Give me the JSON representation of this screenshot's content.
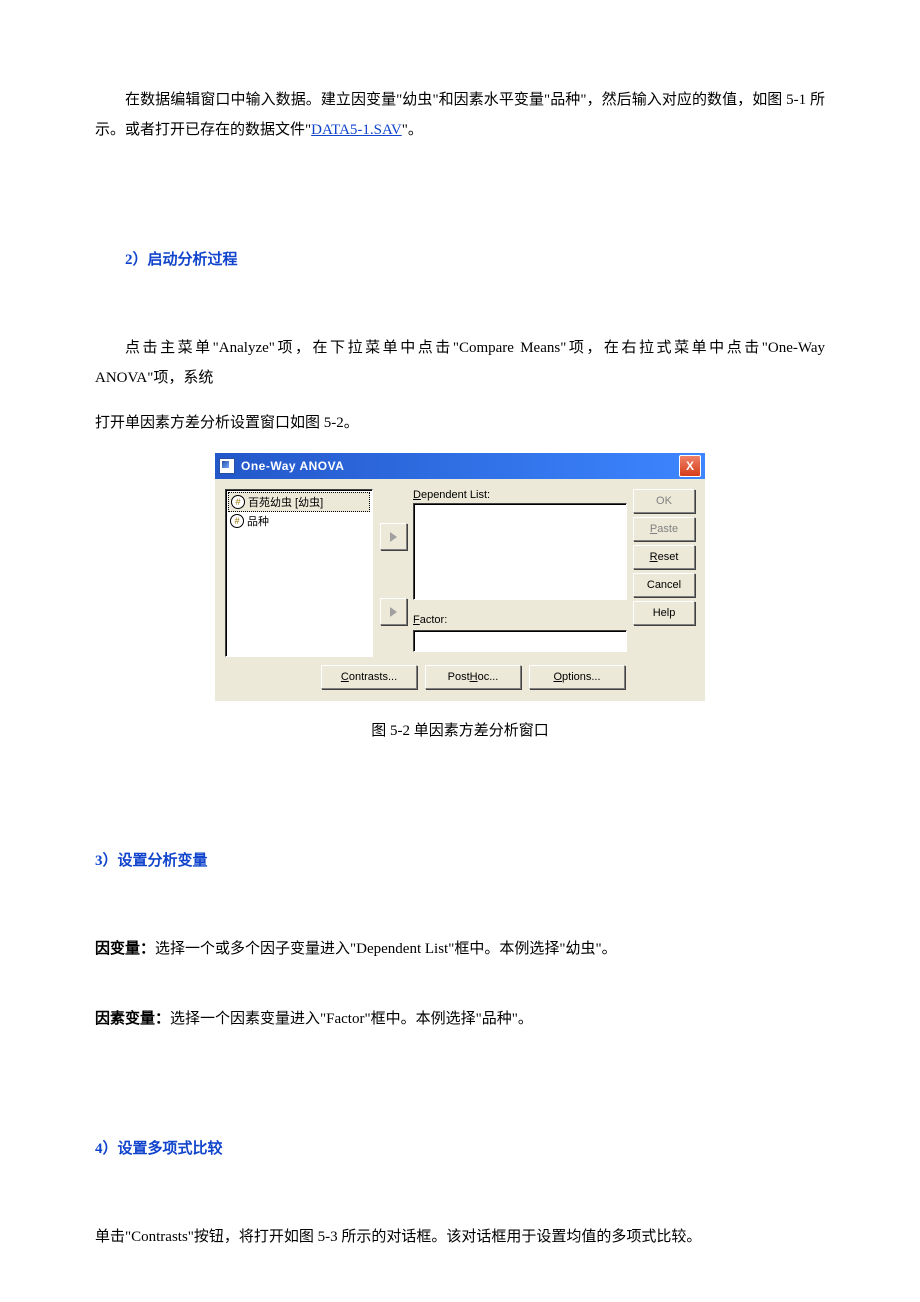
{
  "p1_a": "在数据编辑窗口中输入数据。建立因变量\"幼虫\"和因素水平变量\"品种\"，然后输入对应的数值，如图 5-1 所示。或者打开已存在的数据文件\"",
  "p1_link": "DATA5-1.SAV",
  "p1_b": "\"。",
  "sec2": "2）启动分析过程",
  "p2_a": "点击主菜单\"Analyze\"项，在下拉菜单中点击\"Compare Means\"项，在右拉式菜单中点击\"One-Way ANOVA\"项，系统",
  "p2_b": "打开单因素方差分析设置窗口如图 5-2。",
  "figcap": "图 5-2 单因素方差分析窗口",
  "sec3": "3）设置分析变量",
  "p3a_bold": "因变量：",
  "p3a": "选择一个或多个因子变量进入\"Dependent List\"框中。本例选择\"幼虫\"。",
  "p3b_bold": "因素变量：",
  "p3b": "选择一个因素变量进入\"Factor\"框中。本例选择\"品种\"。",
  "sec4": "4）设置多项式比较",
  "p4": "单击\"Contrasts\"按钮，将打开如图 5-3 所示的对话框。该对话框用于设置均值的多项式比较。",
  "dlg": {
    "title": "One-Way ANOVA",
    "close": "X",
    "vars": {
      "v1": "百苑幼虫 [幼虫]",
      "v2": "品种"
    },
    "dep_label": "Dependent List:",
    "factor_label": "Factor:",
    "buttons": {
      "ok": "OK",
      "paste": "Paste",
      "reset": "Reset",
      "cancel": "Cancel",
      "help": "Help"
    },
    "bottom": {
      "contrasts": "Contrasts...",
      "posthoc": "Post Hoc...",
      "options": "Options..."
    }
  }
}
